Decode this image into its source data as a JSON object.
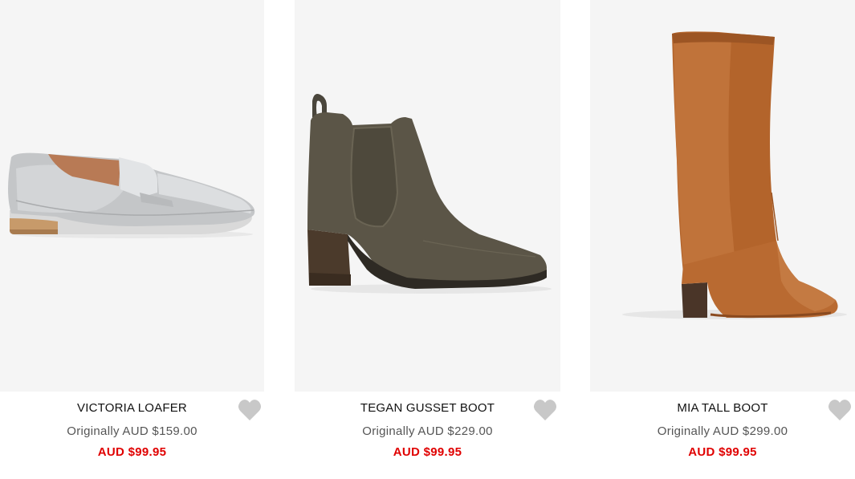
{
  "products": [
    {
      "name": "VICTORIA LOAFER",
      "original_price": "Originally AUD $159.00",
      "sale_price": "AUD $99.95",
      "icon": "heart-icon"
    },
    {
      "name": "TEGAN GUSSET BOOT",
      "original_price": "Originally AUD $229.00",
      "sale_price": "AUD $99.95",
      "icon": "heart-icon"
    },
    {
      "name": "MIA TALL BOOT",
      "original_price": "Originally AUD $299.00",
      "sale_price": "AUD $99.95",
      "icon": "heart-icon"
    }
  ],
  "colors": {
    "image_background": "#f5f5f5",
    "sale_price": "#e00000",
    "original_price": "#555555",
    "heart": "#c8c8c8"
  }
}
